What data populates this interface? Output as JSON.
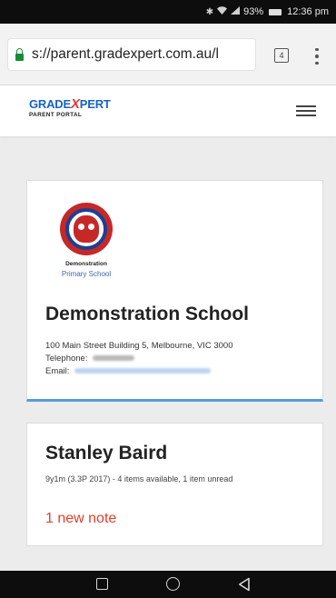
{
  "status_bar": {
    "icons": [
      "bluetooth-icon",
      "wifi-icon",
      "signal-icon",
      "battery-icon"
    ],
    "battery": "93%",
    "time": "12:36 pm"
  },
  "browser": {
    "url": "s://parent.gradexpert.com.au/l",
    "tab_count": "4"
  },
  "brand": {
    "name_part1": "GRADE",
    "name_x": "X",
    "name_part2": "PERT",
    "subtitle": "PARENT PORTAL",
    "colors": {
      "blue": "#1565c0",
      "red": "#e53935"
    }
  },
  "school": {
    "logo_caption_1": "Demonstration",
    "logo_caption_2": "Primary School",
    "name": "Demonstration School",
    "address": "100 Main Street Building 5, Melbourne, VIC 3000",
    "telephone_label": "Telephone:",
    "email_label": "Email:",
    "accent": "#5b9bd5"
  },
  "student": {
    "name": "Stanley Baird",
    "meta": "9y1m (3.3P 2017) - 4 items available, 1 item unread",
    "note": "1 new note",
    "note_color": "#e0402c"
  },
  "nav": {
    "icons": [
      "recent-apps-icon",
      "home-icon",
      "back-icon"
    ]
  }
}
